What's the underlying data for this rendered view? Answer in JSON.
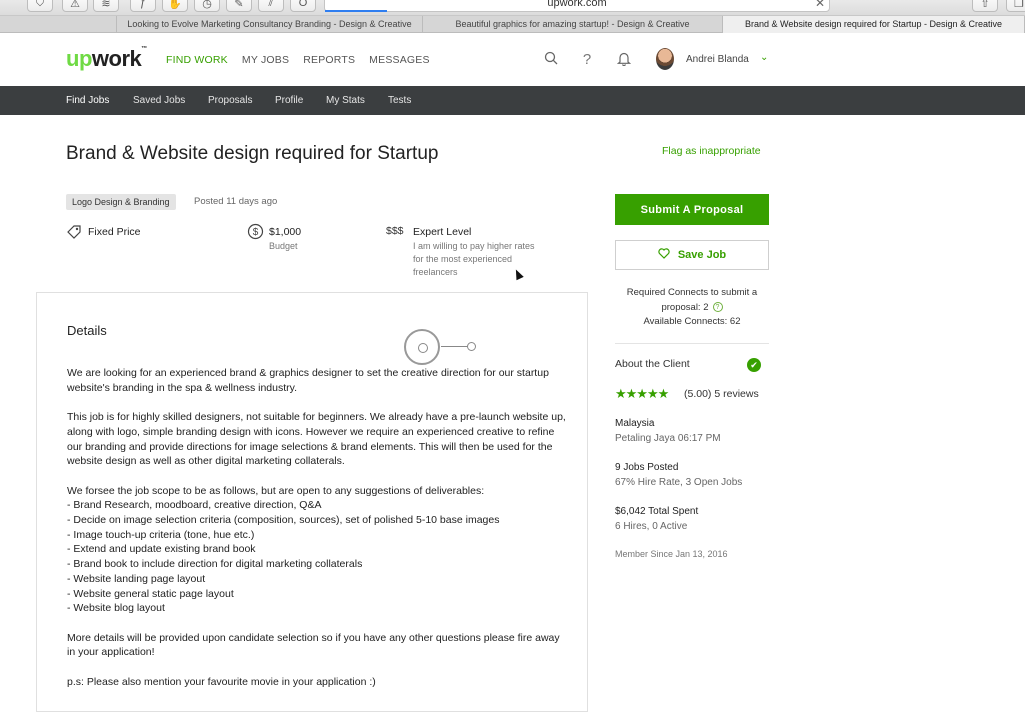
{
  "browser": {
    "url": "upwork.com",
    "tabs": [
      "Looking to Evolve Marketing Consultancy Branding - Design & Creative",
      "Beautiful graphics for amazing startup! - Design & Creative",
      "Brand & Website design required for Startup - Design & Creative"
    ],
    "toolbar_icons": [
      "shield-icon",
      "warning-icon",
      "layers-icon",
      "script-icon",
      "hand-icon",
      "clock-icon",
      "pen-icon",
      "stripes-icon",
      "opera-icon"
    ]
  },
  "header": {
    "logo_up": "up",
    "logo_work": "work",
    "nav": [
      "FIND WORK",
      "MY JOBS",
      "REPORTS",
      "MESSAGES"
    ],
    "user_name": "Andrei Blanda",
    "brand_color": "#37a000"
  },
  "subnav": [
    "Find Jobs",
    "Saved Jobs",
    "Proposals",
    "Profile",
    "My Stats",
    "Tests"
  ],
  "job": {
    "title": "Brand & Website design required for Startup",
    "flag_link": "Flag as inappropriate",
    "skill_tag": "Logo Design & Branding",
    "posted": "Posted 11 days ago",
    "type": "Fixed Price",
    "budget_amount": "$1,000",
    "budget_label": "Budget",
    "level_symbol": "$$$",
    "level_title": "Expert Level",
    "level_desc": "I am willing to pay higher rates for the most experienced freelancers",
    "details_heading": "Details",
    "details_body": "We are looking for an experienced brand & graphics designer to set the creative direction for our startup website's branding in the spa & wellness industry.\n\nThis job is for highly skilled designers, not suitable for beginners. We already have a pre-launch website up, along with logo, simple branding design with icons. However we require an experienced creative to refine our branding and provide directions for image selections & brand elements. This will then be used for the website design as well as other digital marketing collaterals.\n\nWe forsee the job scope to be as follows, but are open to any suggestions of deliverables:\n- Brand Research, moodboard, creative direction, Q&A\n- Decide on image selection criteria (composition, sources), set of polished 5-10 base images\n- Image touch-up criteria (tone, hue etc.)\n- Extend and update existing brand book\n- Brand book to include direction for digital marketing collaterals\n- Website landing page layout\n- Website general static page layout\n- Website blog layout\n\nMore details will be provided upon candidate selection so if you have any other questions please fire away in your application!\n\np.s: Please also mention your favourite movie in your application :)"
  },
  "sidebar": {
    "submit_label": "Submit A Proposal",
    "save_label": "Save Job",
    "connects_line1": "Required Connects to submit a",
    "connects_line2": "proposal: 2",
    "connects_line3": "Available Connects: 62",
    "client_heading": "About the Client",
    "stars": "★★★★★",
    "rating": "(5.00) 5 reviews",
    "country": "Malaysia",
    "city_time": "Petaling Jaya 06:17 PM",
    "jobs_posted": "9 Jobs Posted",
    "hire_rate": "67% Hire Rate, 3 Open Jobs",
    "total_spent": "$6,042 Total Spent",
    "hires": "6 Hires, 0 Active",
    "member_since": "Member Since Jan 13, 2016"
  }
}
